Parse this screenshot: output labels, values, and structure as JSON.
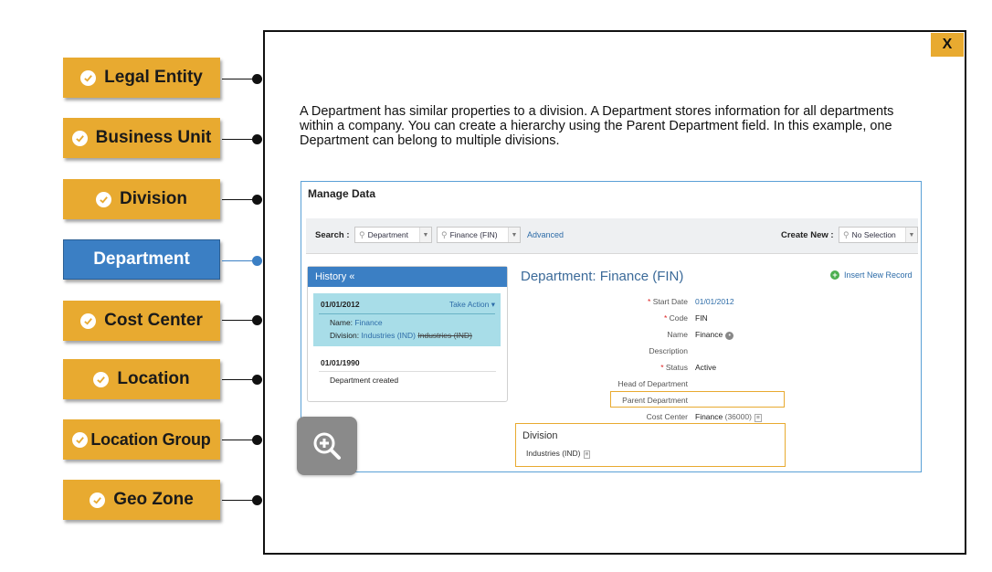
{
  "steps": [
    {
      "label": "Legal Entity",
      "completed": true
    },
    {
      "label": "Business Unit",
      "completed": true
    },
    {
      "label": "Division",
      "completed": true
    },
    {
      "label": "Department",
      "completed": false,
      "active": true
    },
    {
      "label": "Cost Center",
      "completed": true
    },
    {
      "label": "Location",
      "completed": true
    },
    {
      "label": "Location Group",
      "completed": true
    },
    {
      "label": "Geo Zone",
      "completed": true
    }
  ],
  "close_label": "X",
  "description": "A Department has similar properties to a division. A Department stores information for all departments within a company. You can create a hierarchy using the Parent Department field. In this example, one Department can belong to multiple divisions.",
  "screenshot": {
    "title": "Manage Data",
    "search_label": "Search :",
    "search_type": "Department",
    "search_value": "Finance (FIN)",
    "advanced": "Advanced",
    "create_new_label": "Create New :",
    "create_new_value": "No Selection",
    "history": {
      "header": "History «",
      "active_date": "01/01/2012",
      "take_action": "Take Action ▾",
      "name_label": "Name:",
      "name_value": "Finance",
      "division_label": "Division:",
      "division_value": "Industries (IND)",
      "division_old": "Industries (IND)",
      "second_date": "01/01/1990",
      "second_note": "Department created"
    },
    "record_title": "Department: Finance (FIN)",
    "insert_new": "Insert New Record",
    "fields": {
      "start_date_label": "Start Date",
      "start_date": "01/01/2012",
      "code_label": "Code",
      "code": "FIN",
      "name_label": "Name",
      "name": "Finance",
      "description_label": "Description",
      "status_label": "Status",
      "status": "Active",
      "head_label": "Head of Department",
      "parent_label": "Parent Department",
      "cost_center_label": "Cost Center",
      "cost_center": "Finance",
      "cost_center_code": "(36000)"
    },
    "division_box_title": "Division",
    "division_box_value": "Industries (IND)"
  },
  "colors": {
    "accent": "#e8aa30",
    "active": "#3b7fc4"
  }
}
